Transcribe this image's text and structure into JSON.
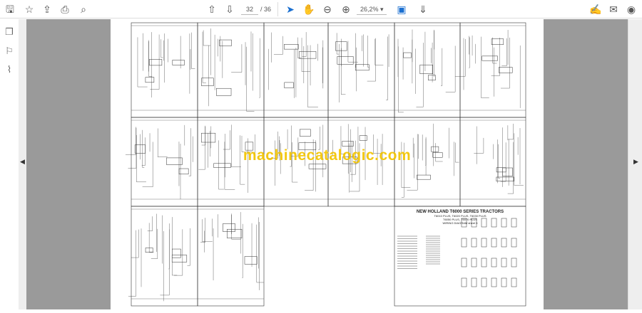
{
  "toolbar": {
    "left_icons": [
      "save-icon",
      "bookmark-star-icon",
      "upload-cloud-icon",
      "print-icon",
      "search-zoom-icon"
    ],
    "current_page": "32",
    "total_pages": "/ 36",
    "zoom": "26,2%",
    "right_icons": [
      "sign-icon",
      "mail-icon",
      "account-icon"
    ]
  },
  "sidebar": {
    "icons": [
      "pages-icon",
      "bookmarks-icon",
      "attachments-icon"
    ]
  },
  "document": {
    "watermark": "machinecatalogic.com",
    "title": "NEW HOLLAND T6000 SERIES TRACTORS",
    "subtitle1": "T6010 PLUS, T6020 PLUS, T6030 PLUS",
    "subtitle2": "T6050 PLUS, T6070 PLUS",
    "subtitle3": "WIRING DIAGRAM sheet 5"
  }
}
